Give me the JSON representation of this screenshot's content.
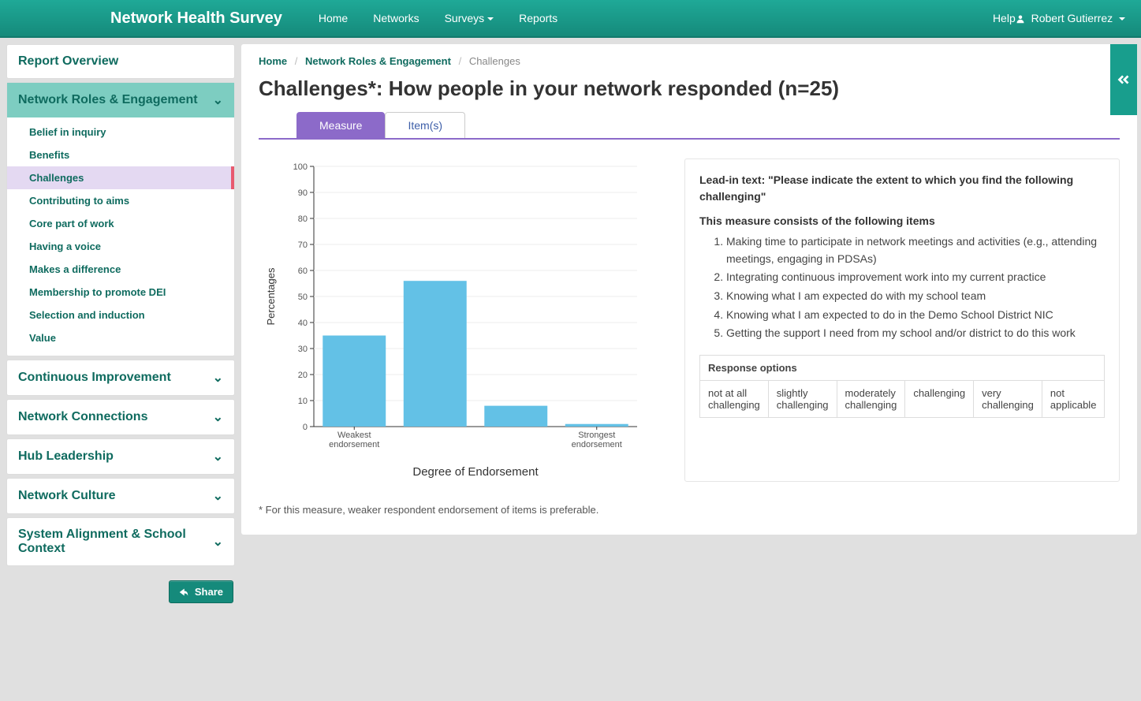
{
  "nav": {
    "brand": "Network Health Survey",
    "links": [
      "Home",
      "Networks",
      "Surveys",
      "Reports"
    ],
    "surveys_has_caret": true,
    "help": "Help",
    "user": "Robert Gutierrez"
  },
  "sidebar": {
    "overview": "Report Overview",
    "sections": [
      {
        "title": "Network Roles & Engagement",
        "expanded": true,
        "items": [
          "Belief in inquiry",
          "Benefits",
          "Challenges",
          "Contributing to aims",
          "Core part of work",
          "Having a voice",
          "Makes a difference",
          "Membership to promote DEI",
          "Selection and induction",
          "Value"
        ],
        "selected_index": 2
      },
      {
        "title": "Continuous Improvement",
        "expanded": false
      },
      {
        "title": "Network Connections",
        "expanded": false
      },
      {
        "title": "Hub Leadership",
        "expanded": false
      },
      {
        "title": "Network Culture",
        "expanded": false
      },
      {
        "title": "System Alignment & School Context",
        "expanded": false
      }
    ],
    "share": "Share"
  },
  "breadcrumb": {
    "home": "Home",
    "section": "Network Roles & Engagement",
    "page": "Challenges"
  },
  "title": "Challenges*: How people in your network responded (n=25)",
  "tabs": {
    "measure": "Measure",
    "items": "Item(s)",
    "active": "measure"
  },
  "info": {
    "lead": "Lead-in text: \"Please indicate the extent to which you find the following challenging\"",
    "stem": "This measure consists of the following items",
    "items": [
      "Making time to participate in network meetings and activities (e.g., attending meetings, engaging in PDSAs)",
      "Integrating continuous improvement work into my current practice",
      "Knowing what I am expected do with my school team",
      "Knowing what I am expected to do in the Demo School District NIC",
      "Getting the support I need from my school and/or district to do this work"
    ],
    "response_header": "Response options",
    "response_options": [
      "not at all challenging",
      "slightly challenging",
      "moderately challenging",
      "challenging",
      "very challenging",
      "not applicable"
    ]
  },
  "footnote": "* For this measure, weaker respondent endorsement of items is preferable.",
  "chart_data": {
    "type": "bar",
    "categories": [
      "Weakest endorsement",
      "",
      "",
      "Strongest endorsement"
    ],
    "values": [
      35,
      56,
      8,
      1
    ],
    "xlabel": "Degree of Endorsement",
    "ylabel": "Percentages",
    "ylim": [
      0,
      100
    ],
    "yticks": [
      0,
      10,
      20,
      30,
      40,
      50,
      60,
      70,
      80,
      90,
      100
    ]
  }
}
